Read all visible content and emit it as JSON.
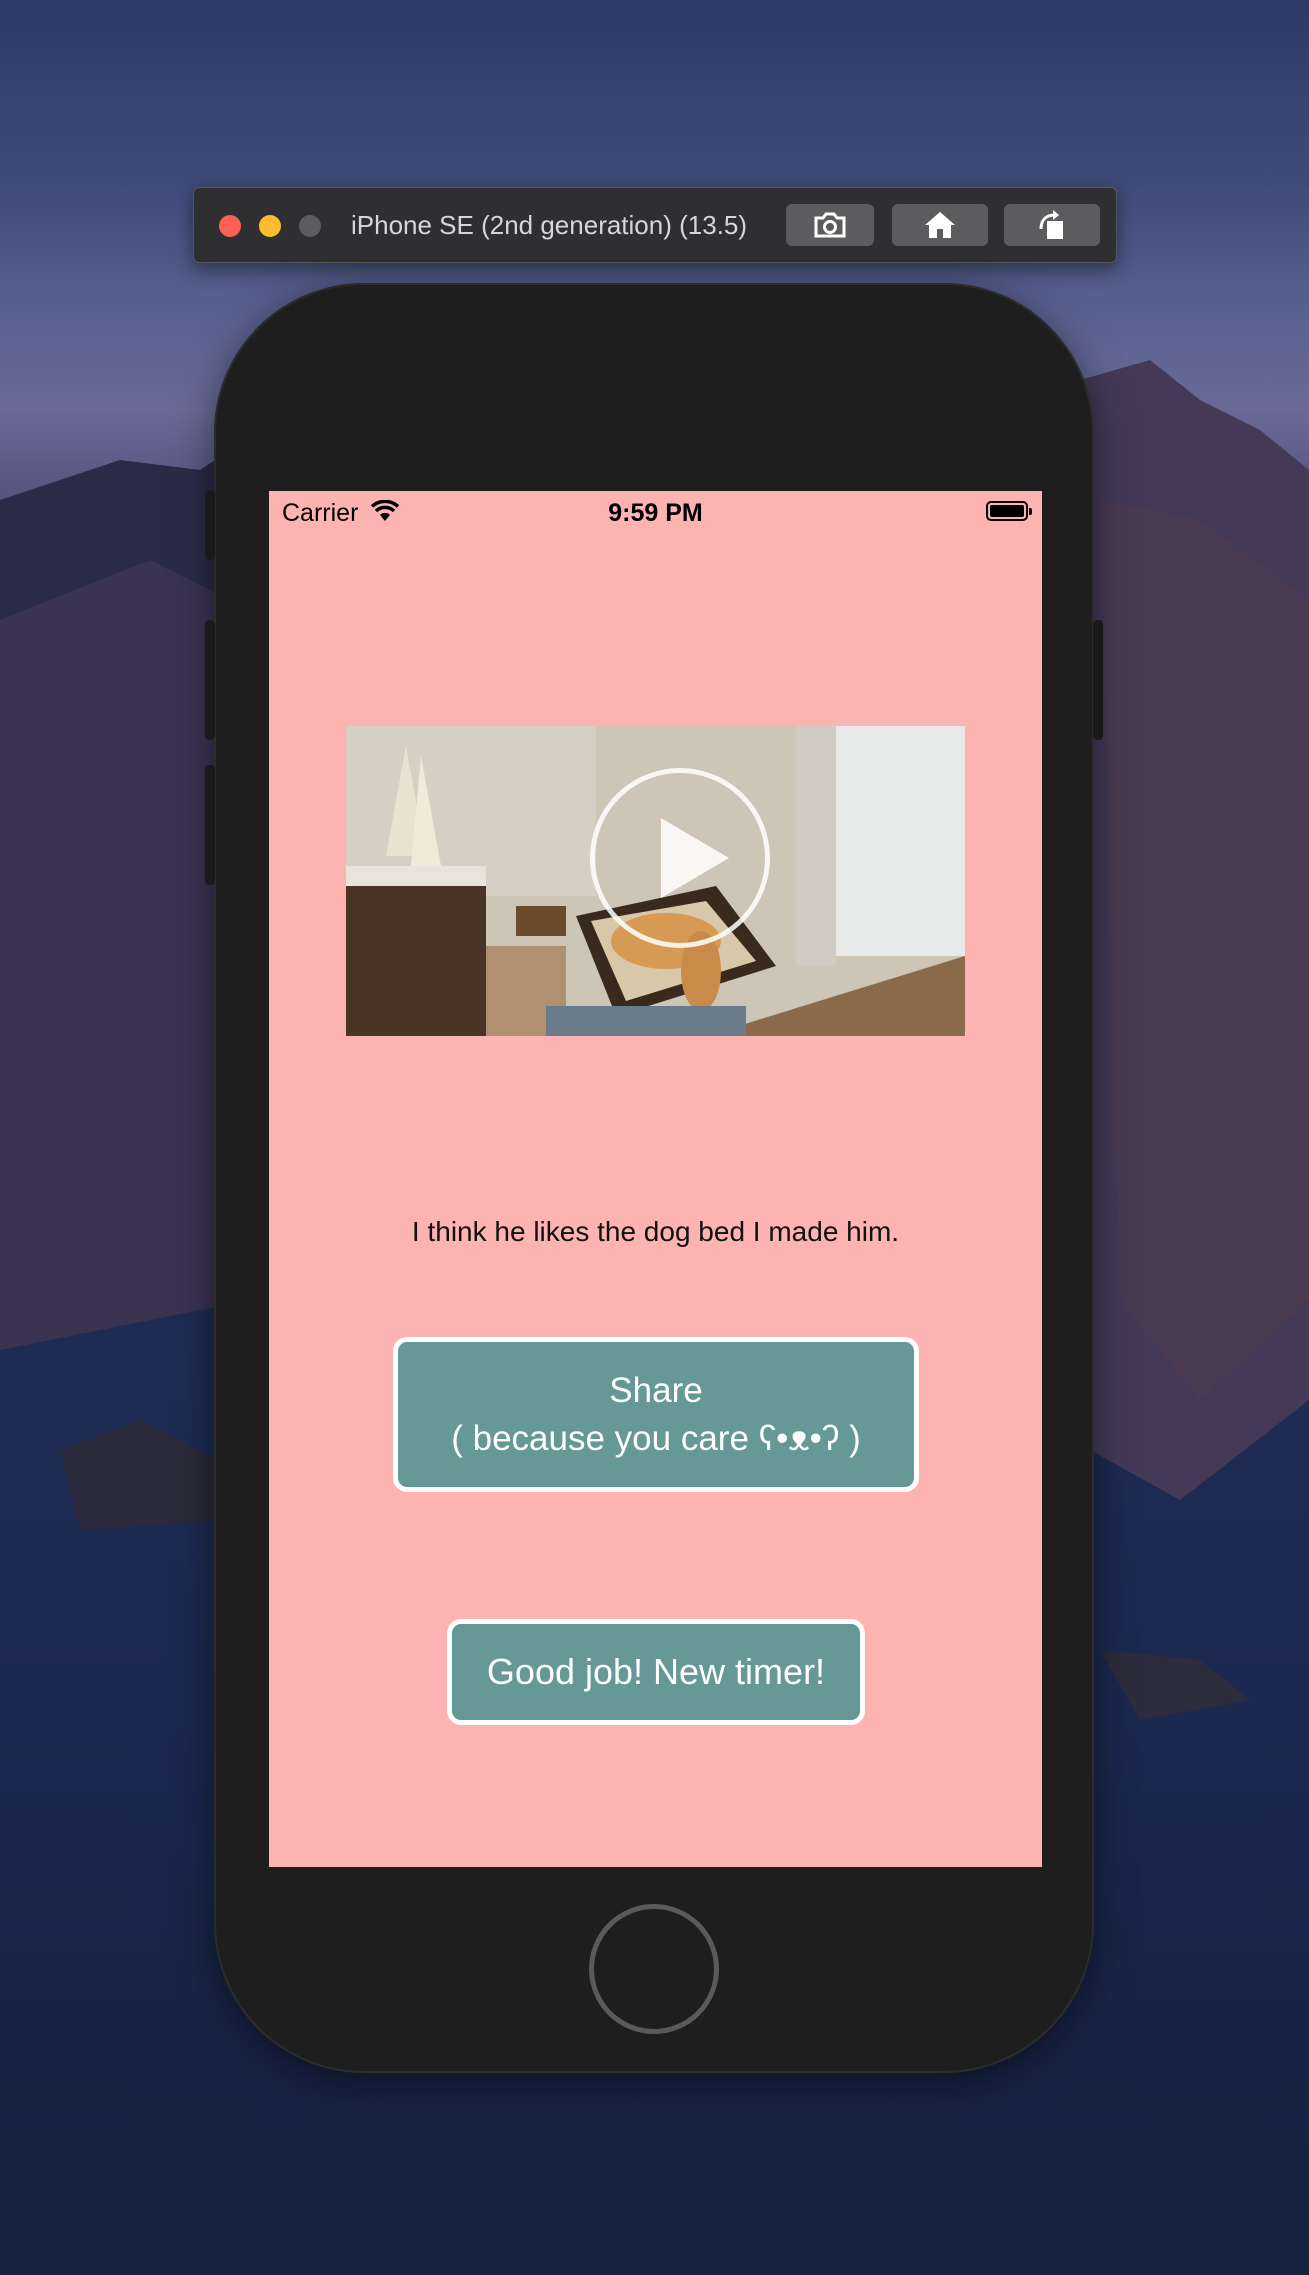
{
  "simulator": {
    "title": "iPhone SE (2nd generation) (13.5)",
    "buttons": [
      {
        "name": "screenshot",
        "icon": "camera-icon"
      },
      {
        "name": "home",
        "icon": "home-icon"
      },
      {
        "name": "rotate",
        "icon": "rotate-icon"
      }
    ],
    "traffic_lights": {
      "close": "#fe5f57",
      "minimize": "#febc2e",
      "zoom": "#5c5c5f"
    }
  },
  "status_bar": {
    "carrier": "Carrier",
    "time": "9:59 PM"
  },
  "app": {
    "background": "#feb3b3",
    "caption": "I think he likes the dog bed I made him.",
    "share_button": {
      "line1": "Share",
      "line2": "( because you care ʕ•ᴥ•ʔ )"
    },
    "new_timer_button": "Good job! New timer!",
    "button_color": "#659897"
  }
}
